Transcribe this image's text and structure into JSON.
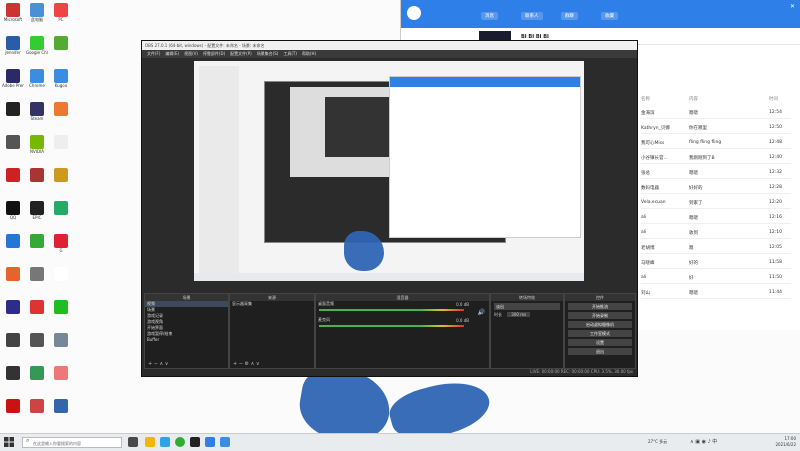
{
  "desktop": {
    "icons": [
      {
        "label": "Microsoft",
        "color": "#c33"
      },
      {
        "label": "此电脑",
        "color": "#4a90d9"
      },
      {
        "label": "PC",
        "color": "#e44"
      },
      {
        "label": "Jennifer",
        "color": "#2a5ca8"
      },
      {
        "label": "Google Chrome",
        "color": "#3c3"
      },
      {
        "label": "",
        "color": "#5a3"
      },
      {
        "label": "Adobe Premi...",
        "color": "#2a2a6b"
      },
      {
        "label": "Chrome",
        "color": "#3a8de0"
      },
      {
        "label": "Kugou",
        "color": "#3a8de0"
      },
      {
        "label": "",
        "color": "#222"
      },
      {
        "label": "Steam",
        "color": "#336"
      },
      {
        "label": "",
        "color": "#e73"
      },
      {
        "label": "",
        "color": "#555"
      },
      {
        "label": "NVIDIA",
        "color": "#76b900"
      },
      {
        "label": "",
        "color": "#eee"
      },
      {
        "label": "",
        "color": "#c22"
      },
      {
        "label": "",
        "color": "#a33"
      },
      {
        "label": "",
        "color": "#c92"
      },
      {
        "label": "QQ",
        "color": "#111"
      },
      {
        "label": "EPIC",
        "color": "#222"
      },
      {
        "label": "",
        "color": "#2a6"
      },
      {
        "label": "",
        "color": "#2477d6"
      },
      {
        "label": "",
        "color": "#3a3"
      },
      {
        "label": "G",
        "color": "#d23"
      },
      {
        "label": "",
        "color": "#e8632a"
      },
      {
        "label": "",
        "color": "#777"
      },
      {
        "label": "",
        "color": "#fff"
      },
      {
        "label": "",
        "color": "#2c2c8c"
      },
      {
        "label": "",
        "color": "#d33"
      },
      {
        "label": "",
        "color": "#2b2"
      },
      {
        "label": "",
        "color": "#444"
      },
      {
        "label": "",
        "color": "#555"
      },
      {
        "label": "",
        "color": "#789"
      },
      {
        "label": "",
        "color": "#333"
      },
      {
        "label": "",
        "color": "#395"
      },
      {
        "label": "",
        "color": "#e77"
      },
      {
        "label": "",
        "color": "#c11"
      },
      {
        "label": "",
        "color": "#c44"
      },
      {
        "label": "",
        "color": "#36a"
      }
    ]
  },
  "chat": {
    "tabs": [
      "消息",
      "联系人",
      "群聊",
      "收藏"
    ],
    "header_title": "BI BI BI BI",
    "columns": [
      "名称",
      "内容",
      "时间"
    ],
    "rows": [
      {
        "name": "金海滨",
        "msg": "嗯嗯",
        "time": "12:54"
      },
      {
        "name": "Kathryn_贝娜",
        "msg": "你在哪里",
        "time": "12:50"
      },
      {
        "name": "我可心Miss",
        "msg": "fling fling fling",
        "time": "12:48"
      },
      {
        "name": "小谷镇长官...",
        "msg": "我刚刚到了B",
        "time": "12:40"
      },
      {
        "name": "张总",
        "msg": "嗯嗯",
        "time": "12:32"
      },
      {
        "name": "数码电器",
        "msg": "好好的",
        "time": "12:28"
      },
      {
        "name": "Vela.ecuan",
        "msg": "到家了",
        "time": "12:20"
      },
      {
        "name": "ali",
        "msg": "嗯嗯",
        "time": "12:16"
      },
      {
        "name": "ali",
        "msg": "收到",
        "time": "12:10"
      },
      {
        "name": "老胡博",
        "msg": "嗯",
        "time": "12:05"
      },
      {
        "name": "马晓峰",
        "msg": "好的",
        "time": "11:58"
      },
      {
        "name": "ali",
        "msg": "好",
        "time": "11:50"
      },
      {
        "name": "刘山",
        "msg": "嗯嗯",
        "time": "11:44"
      }
    ]
  },
  "obs": {
    "title": "OBS 27.0.1 (64-bit, windows) - 配置文件: 未命名 - 场景: 未命名",
    "menu": [
      "文件(F)",
      "编辑(E)",
      "视图(V)",
      "停靠部件(D)",
      "配置文件(P)",
      "场景集合(S)",
      "工具(T)",
      "帮助(H)"
    ],
    "scenes_title": "场景",
    "scenes": [
      "视频",
      "场景",
      "游戏记录",
      "游戏视角",
      "开始界面",
      "游戏暂停/结束",
      "Buffer"
    ],
    "sources_title": "来源",
    "sources": [
      "显示器采集"
    ],
    "mixer_title": "混音器",
    "mixer": [
      {
        "name": "桌面音频",
        "db": "0.0 dB"
      },
      {
        "name": "麦克风",
        "db": "0.0 dB"
      }
    ],
    "transitions_title": "转场特效",
    "transition_value": "淡出",
    "duration_label": "时长",
    "duration": "300 ms",
    "controls_title": "控件",
    "controls": [
      "开始推流",
      "开始录制",
      "启动虚拟摄像机",
      "工作室模式",
      "设置",
      "退出"
    ],
    "status": "LIVE: 00:00:00   REC: 00:00:00   CPU: 3.5%, 30.00 fps"
  },
  "taskbar": {
    "search_placeholder": "在这里输入你要搜索的内容",
    "weather": "27°C 多云",
    "time": "17:00",
    "date": "2021/6/22"
  }
}
